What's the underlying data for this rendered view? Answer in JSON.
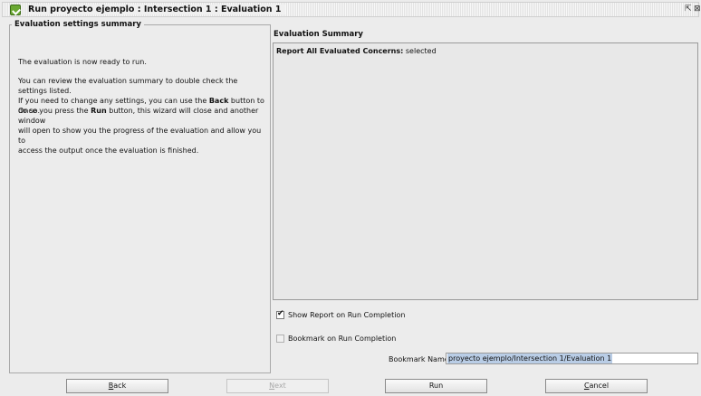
{
  "window": {
    "title": "Run proyecto ejemplo : Intersection 1 : Evaluation 1",
    "restore_glyph": "⇱",
    "maximize_glyph": "⊠"
  },
  "left_panel": {
    "title": "Evaluation settings summary",
    "para1": "The evaluation is now ready to run.",
    "para2_line1": "You can review the evaluation summary to double check the settings listed.",
    "para2_line2_pre": "If you need to change any settings, you can use the ",
    "para2_line2_bold": "Back",
    "para2_line2_post": " button to do so.",
    "para3_line1_pre": "Once you press the ",
    "para3_line1_bold": "Run",
    "para3_line1_post": " button, this wizard will close and another window",
    "para3_line2": "will open to show you the progress of the evaluation and allow you to",
    "para3_line3": "access the output once the evaluation is finished."
  },
  "right_panel": {
    "title": "Evaluation Summary",
    "summary_label": "Report All Evaluated Concerns:",
    "summary_value": " selected",
    "show_report_checkbox": {
      "label": "Show Report on Run Completion",
      "checked": true
    },
    "bookmark_checkbox": {
      "label": "Bookmark on Run Completion",
      "checked": false
    },
    "bookmark_name_label": "Bookmark Name :",
    "bookmark_name_value": "proyecto ejemplo/Intersection 1/Evaluation 1"
  },
  "buttons": {
    "back": {
      "mnemonic": "B",
      "rest": "ack",
      "enabled": true
    },
    "next": {
      "mnemonic": "N",
      "rest": "ext",
      "enabled": false
    },
    "run": {
      "label": "Run",
      "enabled": true
    },
    "cancel": {
      "mnemonic": "C",
      "rest": "ancel",
      "enabled": true
    }
  }
}
